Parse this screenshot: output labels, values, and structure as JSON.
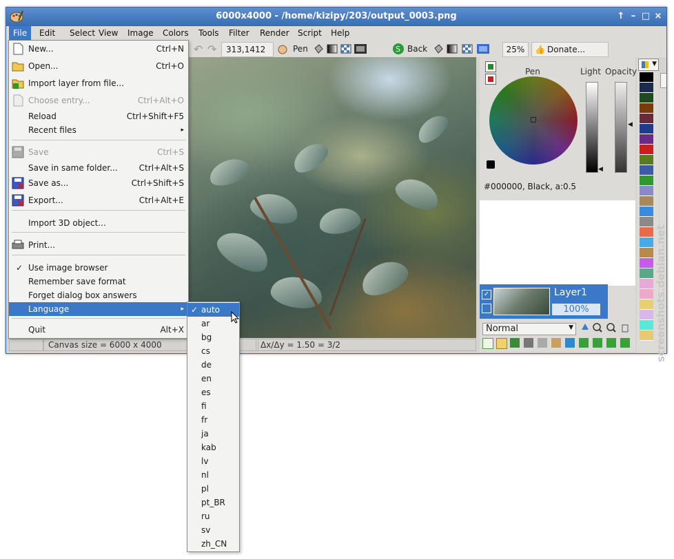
{
  "window": {
    "title": "6000x4000 - /home/kizipy/203/output_0003.png",
    "controls": [
      "↑",
      "–",
      "□",
      "×"
    ]
  },
  "menubar": {
    "items": [
      "File",
      "Edit",
      "Select",
      "View",
      "Image",
      "Colors",
      "Tools",
      "Filter",
      "Render",
      "Script",
      "Help"
    ],
    "active": "File"
  },
  "toolbar": {
    "coords": "313,1412",
    "pen_label": "Pen",
    "back_label": "Back",
    "zoom": "25%",
    "donate_label": "Donate..."
  },
  "file_menu": {
    "items": [
      {
        "label": "New...",
        "shortcut": "Ctrl+N"
      },
      {
        "label": "Open...",
        "shortcut": "Ctrl+O"
      },
      {
        "label": "Import layer from file...",
        "shortcut": ""
      },
      {
        "label": "Choose entry...",
        "shortcut": "Ctrl+Alt+O"
      },
      {
        "label": "Reload",
        "shortcut": "Ctrl+Shift+F5"
      },
      {
        "label": "Recent files",
        "shortcut": ""
      },
      {
        "label": "Save",
        "shortcut": "Ctrl+S"
      },
      {
        "label": "Save in same folder...",
        "shortcut": "Ctrl+Alt+S"
      },
      {
        "label": "Save as...",
        "shortcut": "Ctrl+Shift+S"
      },
      {
        "label": "Export...",
        "shortcut": "Ctrl+Alt+E"
      },
      {
        "label": "Import 3D object...",
        "shortcut": ""
      },
      {
        "label": "Print...",
        "shortcut": ""
      },
      {
        "label": "Use image browser",
        "shortcut": ""
      },
      {
        "label": "Remember save format",
        "shortcut": ""
      },
      {
        "label": "Forget dialog box answers",
        "shortcut": ""
      },
      {
        "label": "Language",
        "shortcut": ""
      },
      {
        "label": "Quit",
        "shortcut": "Alt+X"
      }
    ]
  },
  "language_menu": {
    "items": [
      "auto",
      "ar",
      "bg",
      "cs",
      "de",
      "en",
      "es",
      "fi",
      "fr",
      "ja",
      "kab",
      "lv",
      "nl",
      "pl",
      "pt_BR",
      "ru",
      "sv",
      "zh_CN"
    ],
    "selected": "auto"
  },
  "color_panel": {
    "pen_label": "Pen",
    "light_label": "Light",
    "opacity_label": "Opacity",
    "color_readout": "#000000, Black, a:0.5"
  },
  "layers": {
    "name": "Layer1",
    "opacity": "100%",
    "blend_mode": "Normal"
  },
  "statusbar": {
    "canvas_size": "Canvas size = 6000 x 4000",
    "ratio": "Δx/Δy = 1.50 = 3/2"
  },
  "palette_colors": [
    "#000000",
    "#1b2a4e",
    "#1f4a20",
    "#7a3a0a",
    "#6a2a3a",
    "#1e3c8a",
    "#6a2a8a",
    "#c81e1e",
    "#5a7a1e",
    "#3c5aa6",
    "#2e9a2e",
    "#8a8ac8",
    "#a88a5a",
    "#3a8ae0",
    "#8a8a8a",
    "#e86a4a",
    "#4aaae8",
    "#b88a4a",
    "#c85ae8",
    "#5aa88a",
    "#e8a8d8",
    "#f0a8c8",
    "#e8d070",
    "#d8b8e8",
    "#5ae8d8",
    "#e8c870"
  ],
  "watermark": "screenshots.debian.net"
}
